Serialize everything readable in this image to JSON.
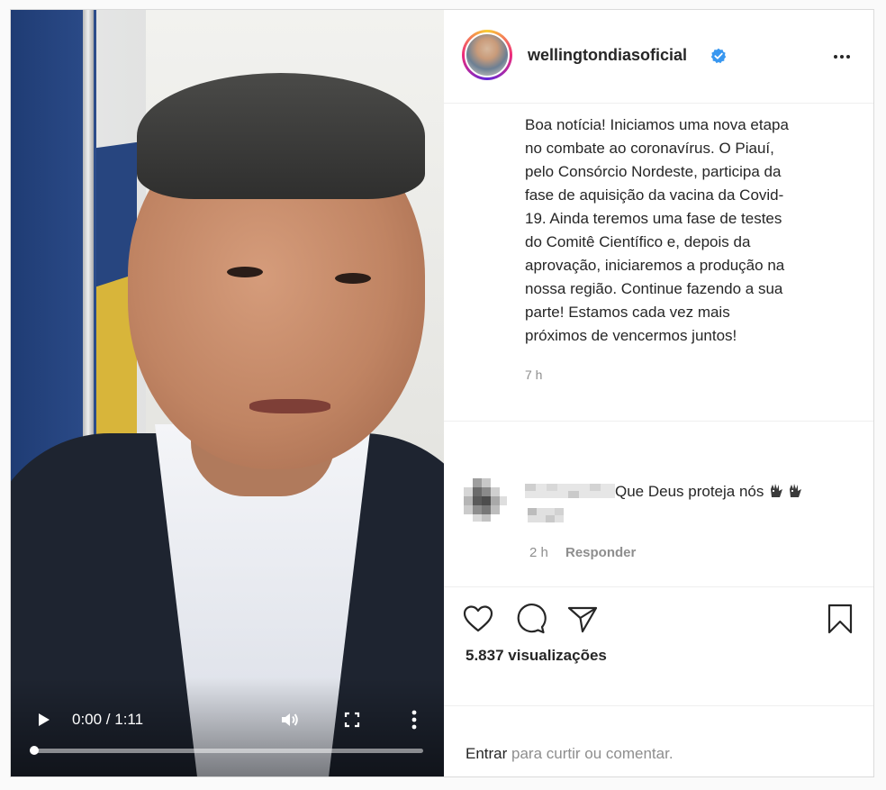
{
  "video": {
    "timecode": "0:00 / 1:11",
    "progress": 0.0
  },
  "header": {
    "username": "wellingtondiasoficial",
    "verified": true,
    "options_icon": "more-horizontal-icon"
  },
  "caption": {
    "lines": [
      "Boa notícia! Iniciamos uma nova etapa",
      "no combate ao coronavírus. O Piauí,",
      "pelo Consórcio Nordeste, participa da",
      "fase de aquisição da vacina da Covid-",
      "19. Ainda teremos uma fase de testes",
      "do Comitê Científico e, depois da",
      "aprovação, iniciaremos a produção na",
      "nossa região. Continue fazendo a sua",
      "parte! Estamos cada vez mais",
      "próximos de vencermos juntos!"
    ],
    "time": "7 h"
  },
  "comment": {
    "text": "Que Deus proteja nós",
    "emoji": "raised-hands-icon",
    "time": "2 h",
    "reply_label": "Responder"
  },
  "actions": {
    "icons": [
      "heart-icon",
      "comment-icon",
      "share-icon",
      "bookmark-icon"
    ],
    "views": "5.837 visualizações"
  },
  "login": {
    "link_label": "Entrar",
    "rest_label": " para curtir ou comentar."
  },
  "colors": {
    "verified": "#3897f0",
    "text": "#262626",
    "muted": "#8e8e8e",
    "border": "#dbdbdb"
  }
}
